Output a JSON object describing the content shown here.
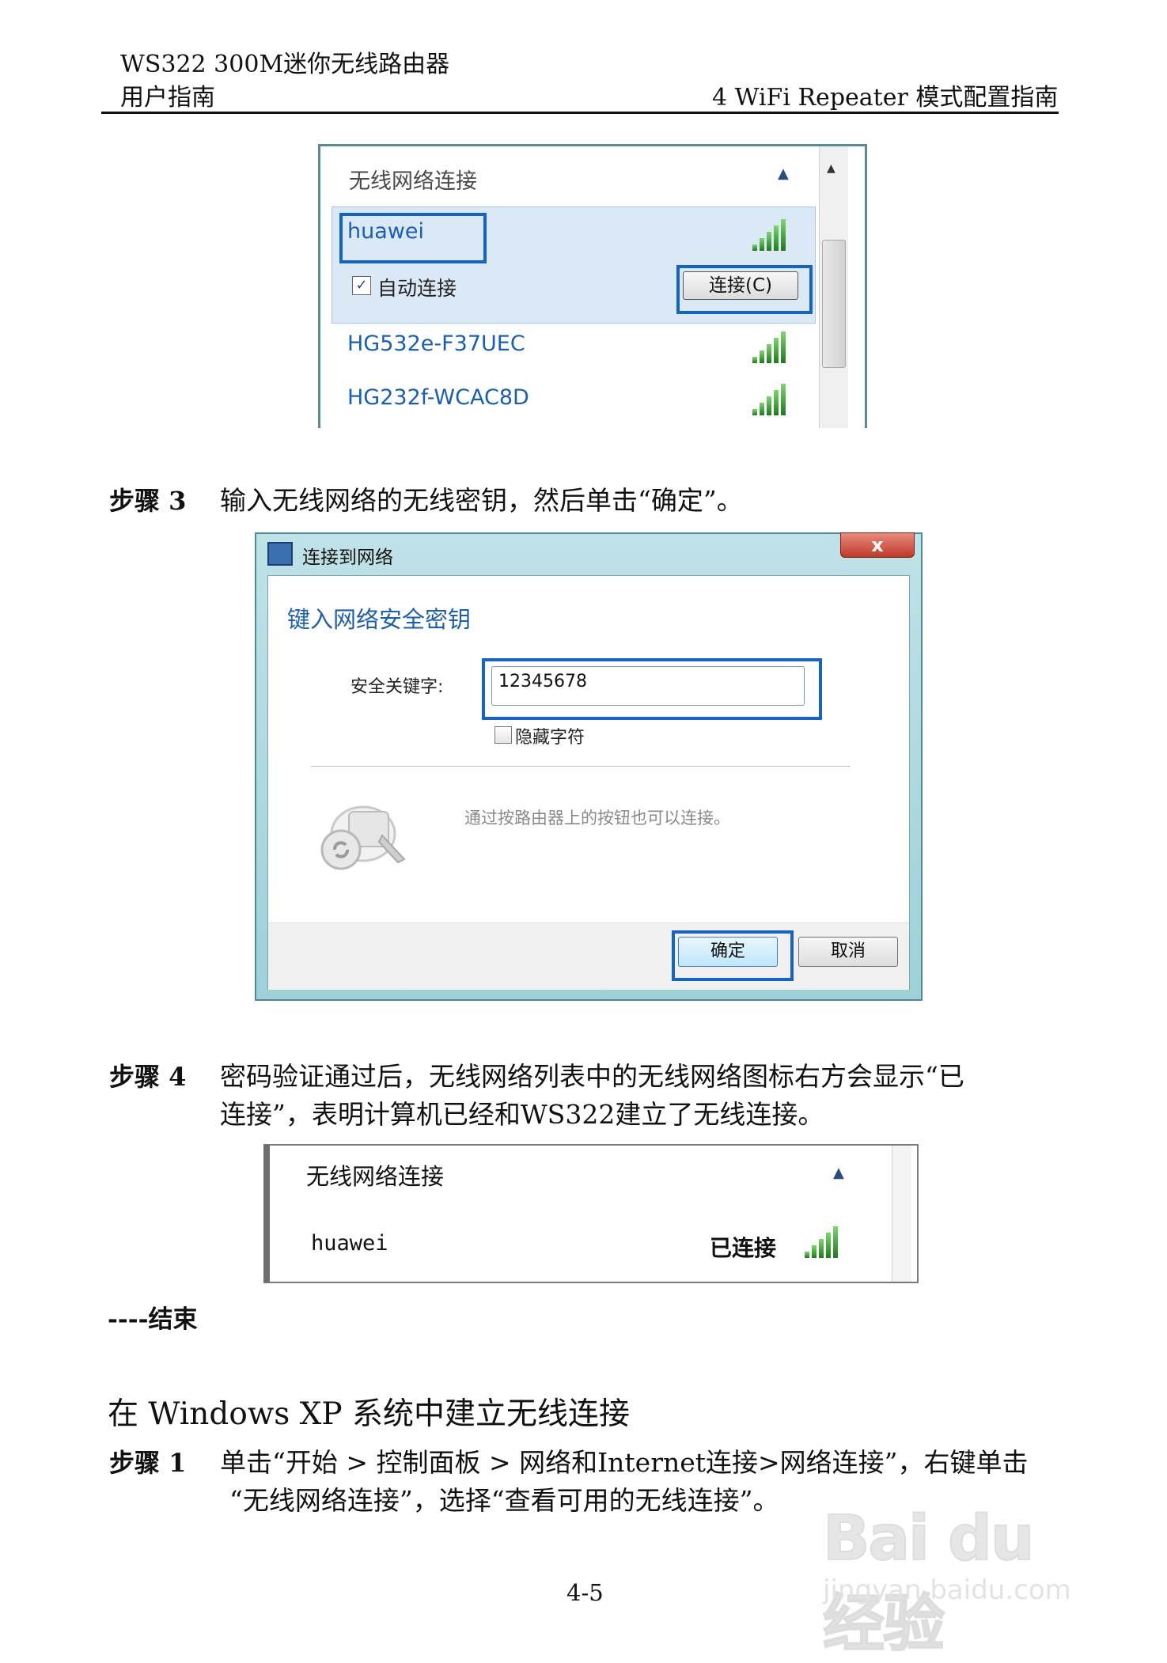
{
  "header": {
    "product": "WS322 300M迷你无线路由器",
    "guide": "用户指南",
    "chapter": "4 WiFi Repeater 模式配置指南"
  },
  "shot1": {
    "title": "无线网络连接",
    "collapse_icon": "chevron-up-icon",
    "selected_network": "huawei",
    "auto_connect_label": "自动连接",
    "connect_button": "连接(C)",
    "networks": [
      "HG532e-F37UEC",
      "HG232f-WCAC8D"
    ],
    "signal_icon": "wifi-signal-icon"
  },
  "step3": {
    "label": "步骤 3",
    "text": "输入无线网络的无线密钥，然后单击“确定”。"
  },
  "shot2": {
    "window_title": "连接到网络",
    "close_label": "x",
    "heading": "键入网络安全密钥",
    "key_label": "安全关键字:",
    "key_value": "12345678",
    "hide_chars_label": "隐藏字符",
    "wps_text": "通过按路由器上的按钮也可以连接。",
    "ok_button": "确定",
    "cancel_button": "取消"
  },
  "step4": {
    "label": "步骤 4",
    "text_line1": "密码验证通过后，无线网络列表中的无线网络图标右方会显示“已",
    "text_line2": "连接”，表明计算机已经和WS322建立了无线连接。"
  },
  "shot3": {
    "title": "无线网络连接",
    "network": "huawei",
    "status": "已连接"
  },
  "end_text": "----结束",
  "section_title": "在 Windows XP 系统中建立无线连接",
  "step1": {
    "label": "步骤 1",
    "text_line1": "单击“开始 > 控制面板 > 网络和Internet连接>网络连接”，右键单击",
    "text_line2": "“无线网络连接”，选择“查看可用的无线连接”。"
  },
  "page_number": "4-5",
  "watermark": {
    "brand": "Bai du 经验",
    "url": "jingyan.baidu.com"
  }
}
